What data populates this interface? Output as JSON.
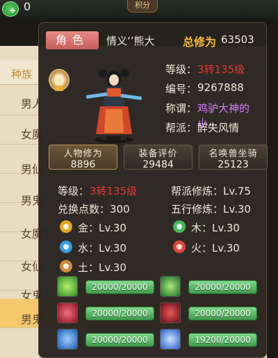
{
  "topbar": {
    "currency_value": "0",
    "tab_label": "积分"
  },
  "background_list": {
    "header": "种族",
    "rows": [
      "男人",
      "女魔",
      "男仙",
      "男鬼",
      "女魔",
      "女仙",
      "女鬼",
      "男鬼"
    ]
  },
  "panel": {
    "role_tag": "角色",
    "player_name": "情义‘’熊大",
    "total_cultivation_label": "总修为",
    "total_cultivation_value": "63503",
    "info": {
      "level_label": "等级：",
      "level_value": "3转135级",
      "id_label": "编号：",
      "id_value": "9267888",
      "title_label": "称谓：",
      "title_value": "鸡驴大神的小...",
      "guild_label": "帮派：",
      "guild_value": "醉失风情"
    },
    "stats": [
      {
        "title": "人物修为",
        "value": "8896"
      },
      {
        "title": "装备评价",
        "value": "29484"
      },
      {
        "title": "名唤兽坐骑",
        "value": "25123"
      }
    ],
    "attrs": {
      "level_label": "等级：",
      "level_value": "3转135级",
      "exchange_points": "兑换点数：300",
      "guild_cult": "帮派修炼：Lv.75",
      "five_elements_cult": "五行修炼：Lv.30"
    },
    "elements": [
      {
        "name": "金：Lv.30",
        "icon": "metal-icon",
        "color": "#e8a524"
      },
      {
        "name": "木：Lv.30",
        "icon": "wood-icon",
        "color": "#49b85a"
      },
      {
        "name": "水：Lv.30",
        "icon": "water-icon",
        "color": "#3c9be0"
      },
      {
        "name": "火：Lv.30",
        "icon": "fire-icon",
        "color": "#e0443a"
      },
      {
        "name": "土：Lv.30",
        "icon": "earth-icon",
        "color": "#d08a3a"
      }
    ],
    "skills": [
      {
        "value": "20000/20000",
        "icon": "wind-skill-icon",
        "color": "#3fbf3f"
      },
      {
        "value": "20000/20000",
        "icon": "leaf-skill-icon",
        "color": "#3aa84a"
      },
      {
        "value": "20000/20000",
        "icon": "blood-skill-icon",
        "color": "#c8243a"
      },
      {
        "value": "20000/20000",
        "icon": "crimson-skill-icon",
        "color": "#b01a2a"
      },
      {
        "value": "20000/20000",
        "icon": "ice-skill-icon",
        "color": "#2a78d0"
      },
      {
        "value": "19200/20000",
        "icon": "frost-skill-icon",
        "color": "#4a82e0"
      }
    ]
  }
}
